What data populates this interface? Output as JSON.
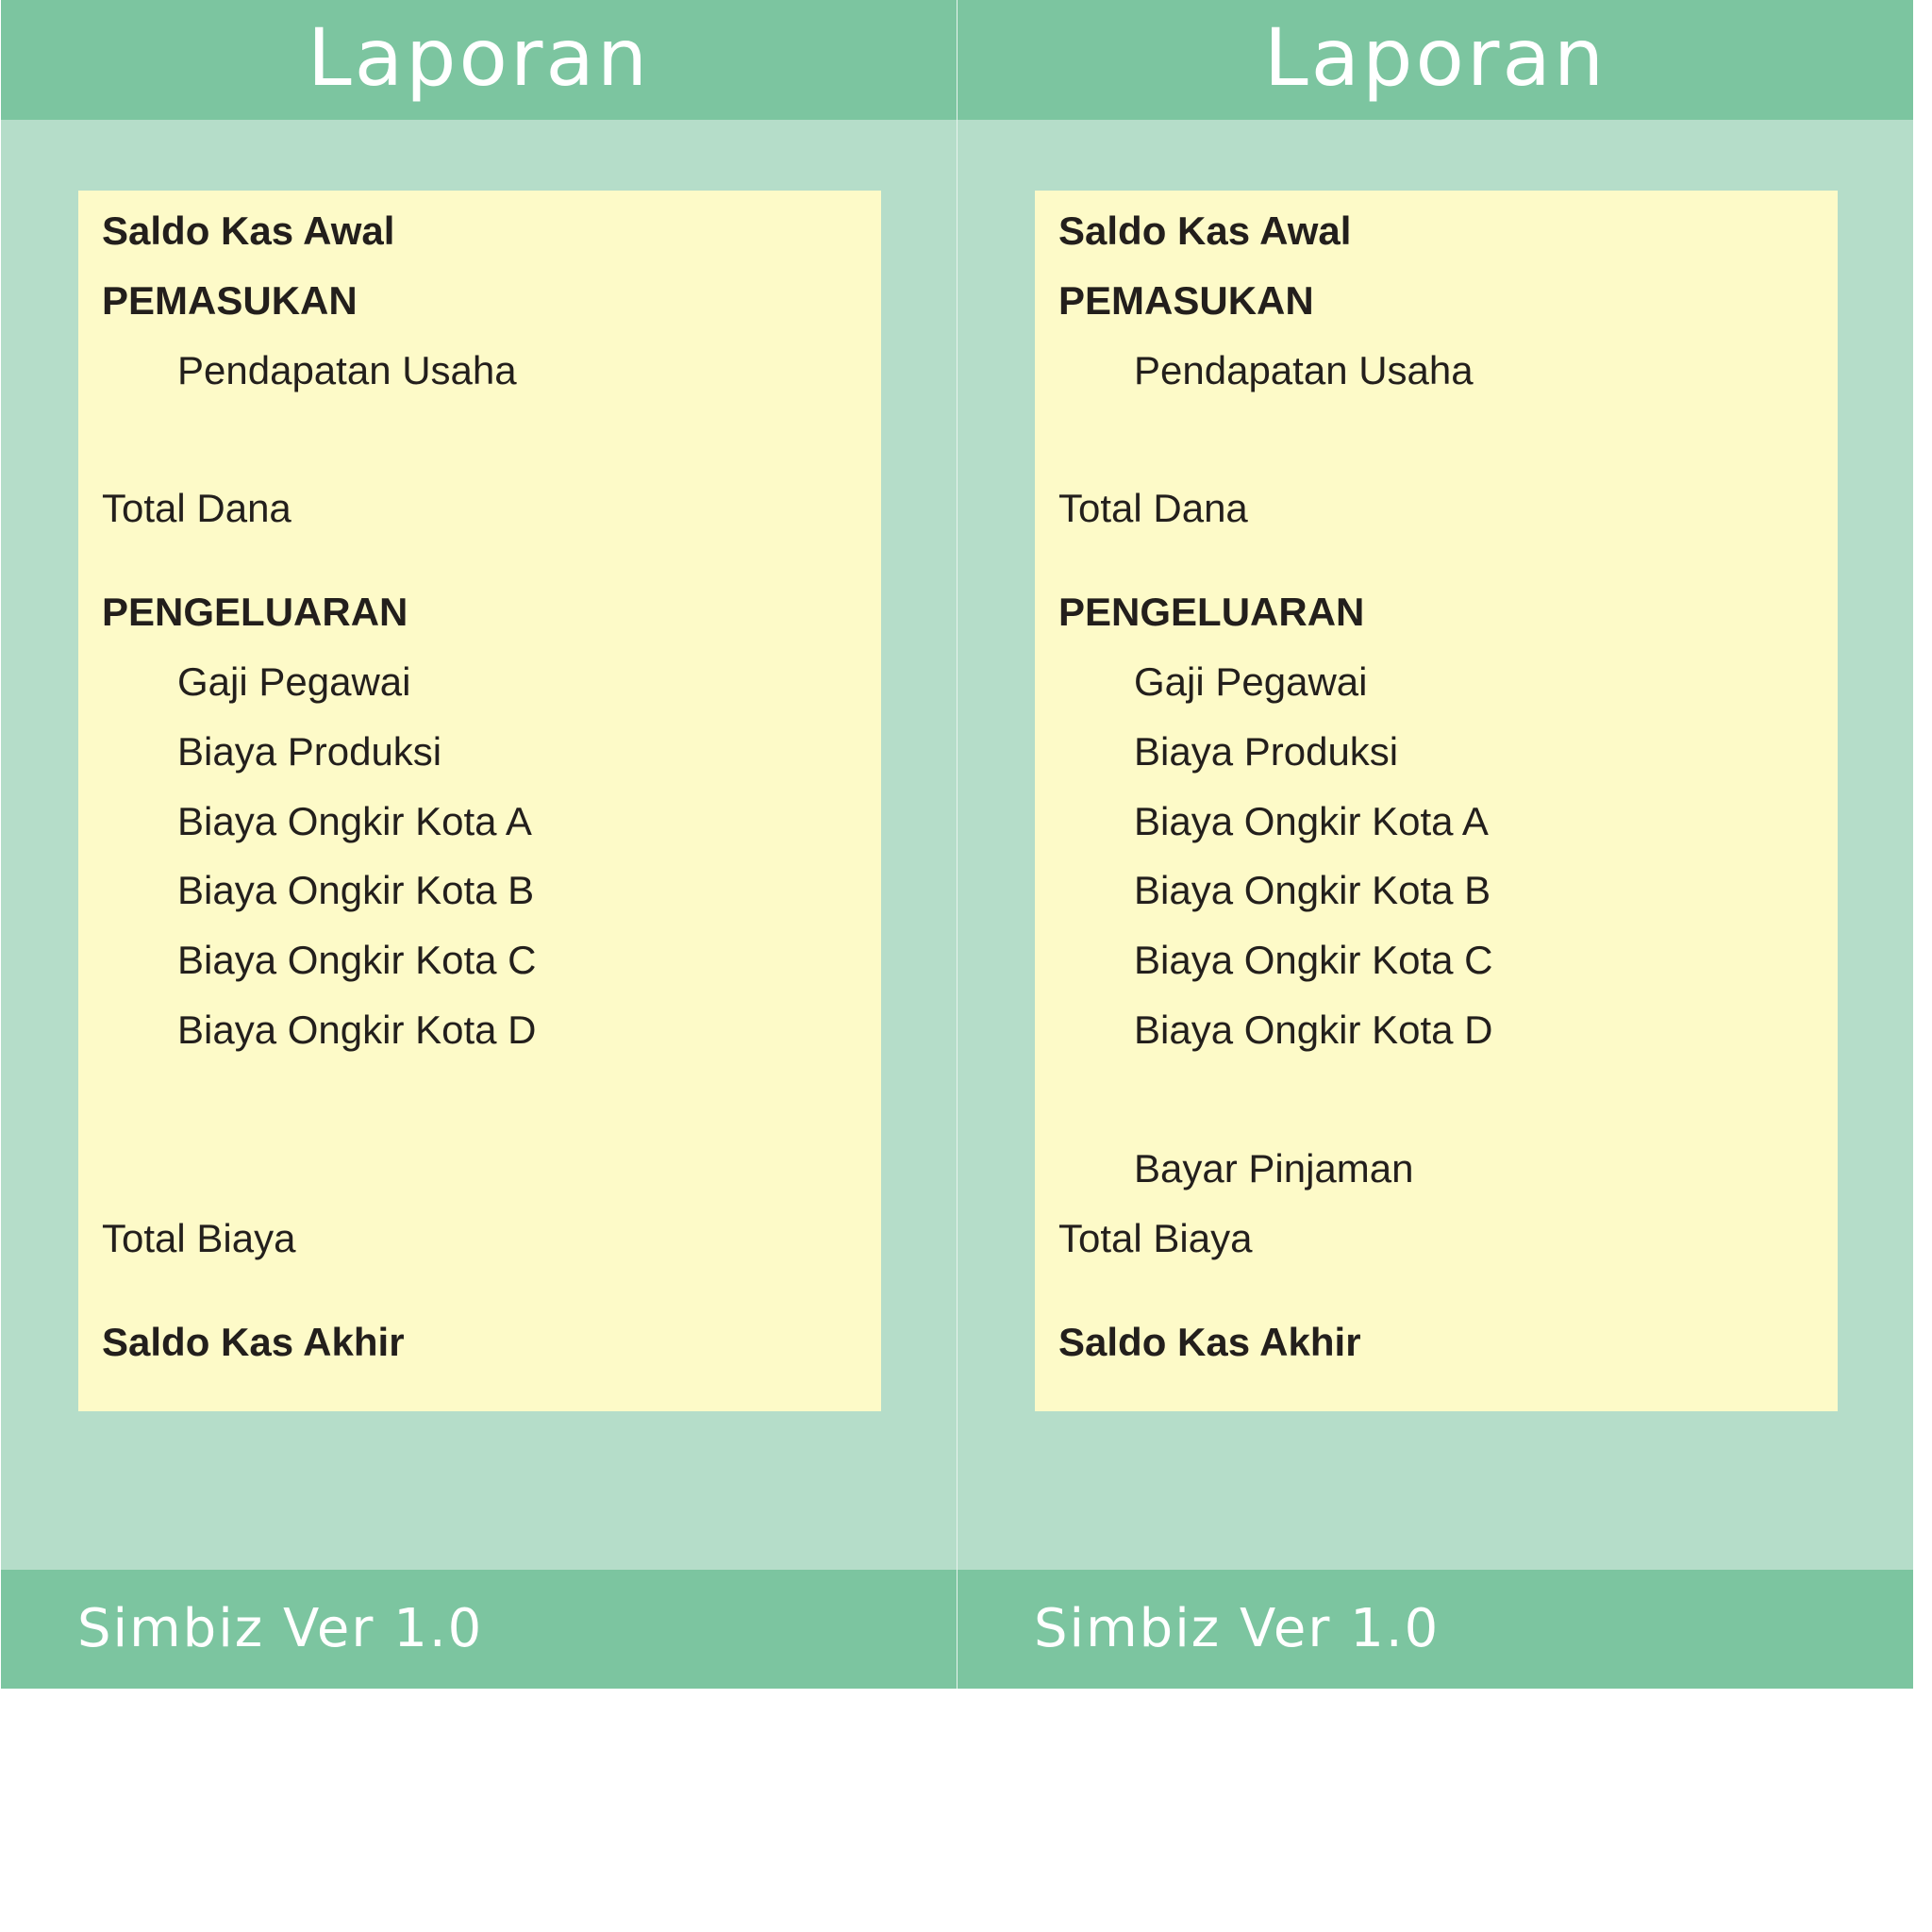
{
  "screens": [
    {
      "header_title": "Laporan",
      "rows": [
        {
          "label": "Saldo Kas Awal",
          "style": "bold"
        },
        {
          "label": "PEMASUKAN",
          "style": "bold"
        },
        {
          "label": "Pendapatan Usaha",
          "style": "indent"
        },
        {
          "label": "Total Dana",
          "style": "normal"
        },
        {
          "label": "PENGELUARAN",
          "style": "bold"
        },
        {
          "label": "Gaji Pegawai",
          "style": "indent"
        },
        {
          "label": "Biaya Produksi",
          "style": "indent"
        },
        {
          "label": "Biaya Ongkir Kota A",
          "style": "indent"
        },
        {
          "label": "Biaya Ongkir Kota B",
          "style": "indent"
        },
        {
          "label": "Biaya Ongkir Kota C",
          "style": "indent"
        },
        {
          "label": "Biaya Ongkir Kota D",
          "style": "indent"
        },
        {
          "label": "Total Biaya",
          "style": "normal"
        },
        {
          "label": "Saldo Kas Akhir",
          "style": "bold"
        }
      ],
      "footer_text": "Simbiz Ver 1.0"
    },
    {
      "header_title": "Laporan",
      "rows": [
        {
          "label": "Saldo Kas Awal",
          "style": "bold"
        },
        {
          "label": "PEMASUKAN",
          "style": "bold"
        },
        {
          "label": "Pendapatan Usaha",
          "style": "indent"
        },
        {
          "label": "Total Dana",
          "style": "normal"
        },
        {
          "label": "PENGELUARAN",
          "style": "bold"
        },
        {
          "label": "Gaji Pegawai",
          "style": "indent"
        },
        {
          "label": "Biaya Produksi",
          "style": "indent"
        },
        {
          "label": "Biaya Ongkir Kota A",
          "style": "indent"
        },
        {
          "label": "Biaya Ongkir Kota B",
          "style": "indent"
        },
        {
          "label": "Biaya Ongkir Kota C",
          "style": "indent"
        },
        {
          "label": "Biaya Ongkir Kota D",
          "style": "indent"
        },
        {
          "label": "Bayar Pinjaman",
          "style": "indent"
        },
        {
          "label": "Total Biaya",
          "style": "normal"
        },
        {
          "label": "Saldo Kas Akhir",
          "style": "bold"
        }
      ],
      "footer_text": "Simbiz Ver 1.0"
    }
  ],
  "colors": {
    "bar": "#7cc5a0",
    "background": "#b5ddc9",
    "panel": "#fdfac8",
    "text": "#231f1c"
  }
}
